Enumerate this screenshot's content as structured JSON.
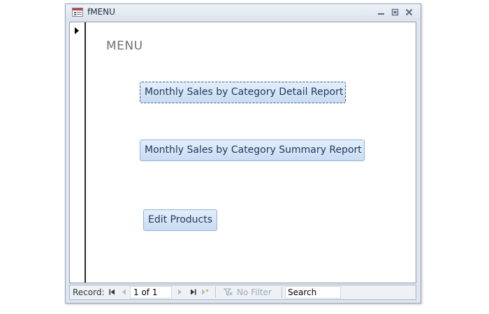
{
  "window": {
    "title": "fMENU"
  },
  "form": {
    "heading": "MENU",
    "buttons": {
      "detail_report": "Monthly Sales by Category Detail Report",
      "summary_report": "Monthly Sales by Category Summary Report",
      "edit_products": "Edit Products"
    }
  },
  "navigation": {
    "record_label": "Record:",
    "record_position": "1 of 1",
    "filter_label": "No Filter",
    "search_label": "Search"
  },
  "icons": {
    "form": "form-icon",
    "minimize": "minimize-icon",
    "restore": "restore-icon",
    "close": "close-icon",
    "record_selector": "current-record-arrow-icon",
    "first": "first-record-icon",
    "previous": "previous-record-icon",
    "next": "next-record-icon",
    "last": "last-record-icon",
    "new": "new-record-icon",
    "filter": "filter-icon"
  },
  "colors": {
    "button_fill": "#c9dcf2",
    "button_border": "#8fb3d9",
    "heading_text": "#707070"
  }
}
